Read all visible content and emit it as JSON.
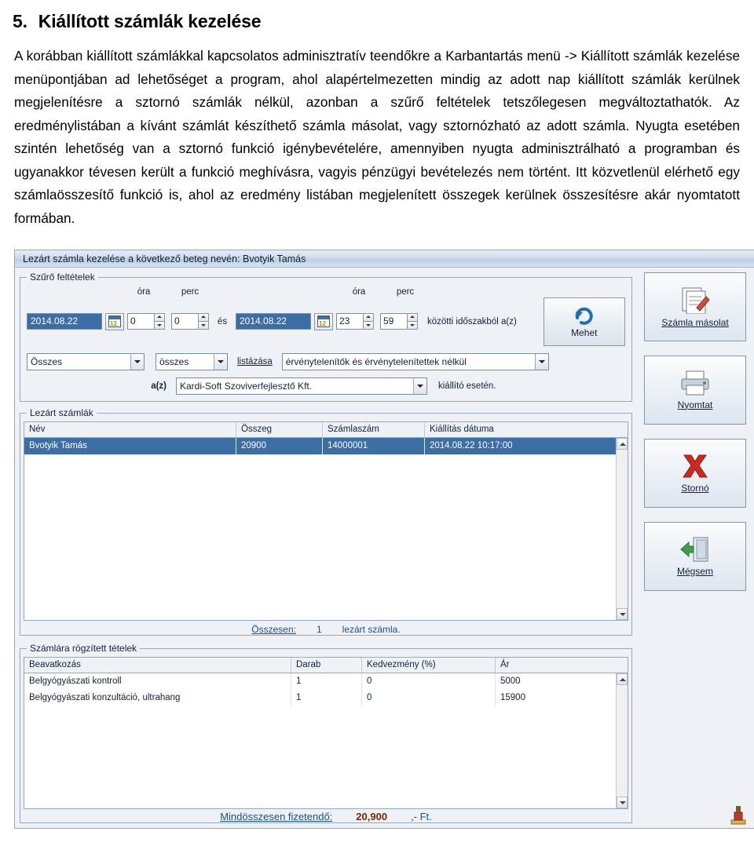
{
  "heading": {
    "number": "5.",
    "text": "Kiállított számlák kezelése"
  },
  "paragraph": "A korábban kiállított számlákkal kapcsolatos adminisztratív teendőkre a Karbantartás menü -> Kiállított számlák kezelése menüpontjában ad lehetőséget a program, ahol alapértelmezetten mindig az adott nap kiállított számlák kerülnek megjelenítésre a sztornó számlák nélkül, azonban a szűrő feltételek tetszőlegesen megváltoztathatók. Az eredménylistában a kívánt számlát készíthető számla másolat, vagy sztornózható az adott számla. Nyugta esetében szintén lehetőség van a sztornó funkció igénybevételére, amennyiben nyugta adminisztrálható a programban és ugyanakkor tévesen került a funkció meghívásra, vagyis pénzügyi bevételezés nem történt. Itt közvetlenül elérhető egy számlaösszesítő funkció is, ahol az eredmény listában megjelenített összegek kerülnek összesítésre akár nyomtatott formában.",
  "screenshot": {
    "title_bar": "Lezárt számla kezelése a következő beteg nevén: Bvotyik Tamás",
    "filter": {
      "legend": "Szűrő feltételek",
      "col_headers": {
        "hour": "óra",
        "minute": "perc"
      },
      "date_from": "2014.08.22",
      "hour_from": "0",
      "minute_from": "0",
      "and_label": "és",
      "date_to": "2014.08.22",
      "hour_to": "23",
      "minute_to": "59",
      "between_label": "közötti időszakból a(z)",
      "mehet_button": "Mehet",
      "type_combo": "Összes",
      "all_combo": "összes",
      "listing_label": "listázása",
      "invalid_combo": "érvénytelenítők és érvénytelenítettek nélkül",
      "az_label": "a(z)",
      "company_combo": "Kardi-Soft Szoviverfejlesztő Kft.",
      "issuer_label": "kiállító esetén."
    },
    "invoices": {
      "legend": "Lezárt számlák",
      "columns": [
        "Név",
        "Összeg",
        "Számlaszám",
        "Kiállítás dátuma"
      ],
      "rows": [
        {
          "nev": "Bvotyik Tamás",
          "osszeg": "20900",
          "szamlaszam": "14000001",
          "datum": "2014.08.22 10:17:00"
        }
      ],
      "summary_label": "Összesen:",
      "summary_count": "1",
      "summary_suffix": "lezárt számla."
    },
    "items": {
      "legend": "Számlára rögzített tételek",
      "columns": [
        "Beavatkozás",
        "Darab",
        "Kedvezmény (%)",
        "Ár"
      ],
      "rows": [
        {
          "beavatkozas": "Belgyógyászati kontroll",
          "darab": "1",
          "kedvezmeny": "0",
          "ar": "5000"
        },
        {
          "beavatkozas": "Belgyógyászati konzultáció, ultrahang",
          "darab": "1",
          "kedvezmeny": "0",
          "ar": "15900"
        }
      ],
      "total_label": "Mindösszesen fizetendő:",
      "total_amount": "20,900",
      "total_currency": ",- Ft."
    },
    "side_buttons": [
      {
        "label": "Számla másolat",
        "icon": "copy-document-icon"
      },
      {
        "label": "Nyomtat",
        "icon": "printer-icon"
      },
      {
        "label": "Stornó",
        "icon": "red-x-icon"
      },
      {
        "label": "Mégsem",
        "icon": "exit-door-icon"
      }
    ],
    "colors": {
      "selection": "#3a6ea5",
      "link_text": "#1b4f8a",
      "amount": "#7a2a00",
      "titlebar": "#cfdcec"
    }
  }
}
